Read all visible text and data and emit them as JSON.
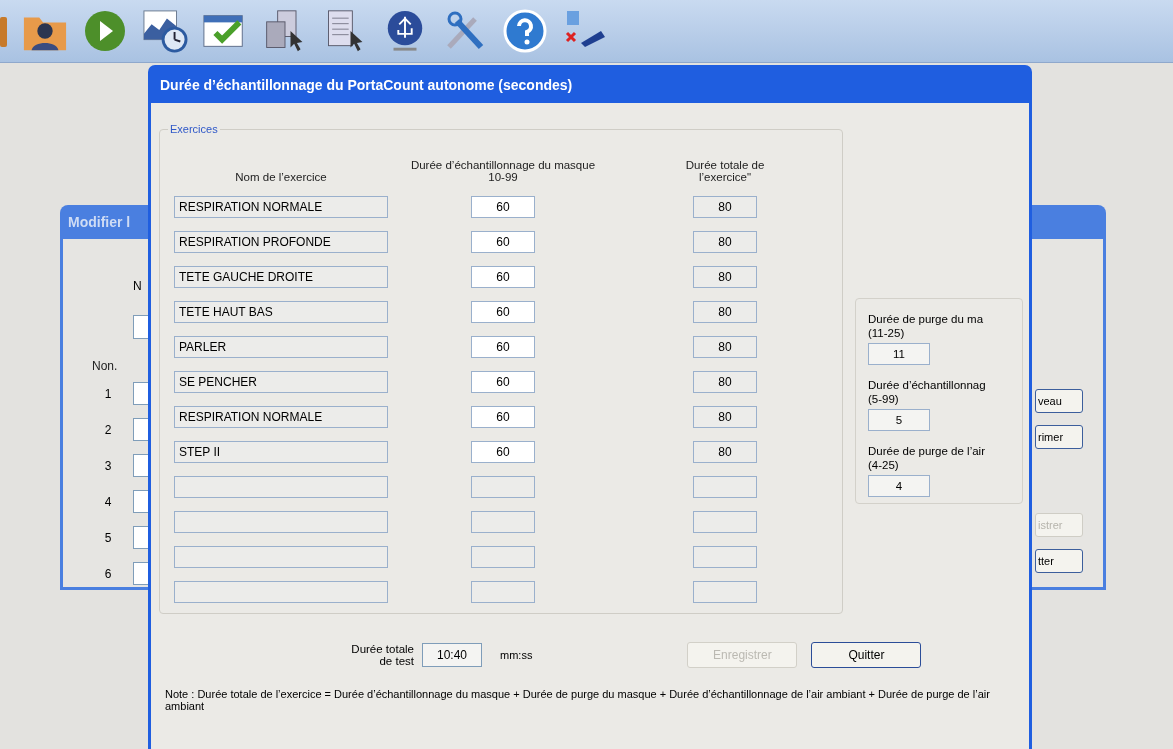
{
  "background_window": {
    "title": "Modifier l",
    "label_top": "N",
    "column_label": "Non.",
    "row_numbers": [
      "1",
      "2",
      "3",
      "4",
      "5",
      "6"
    ],
    "buttons": [
      {
        "label": "veau",
        "disabled": false
      },
      {
        "label": "rimer",
        "disabled": false
      },
      {
        "label": "istrer",
        "disabled": true
      },
      {
        "label": "tter",
        "disabled": false
      }
    ]
  },
  "dialog": {
    "title": "Durée d’échantillonnage du PortaCount autonome (secondes)",
    "group_title": "Exercices",
    "columns": [
      {
        "label": "Nom de l’exercice"
      },
      {
        "label": "Durée d’échantillonnage du masque",
        "range": "10-99"
      },
      {
        "label": "Durée totale de l’exercice\""
      }
    ],
    "rows": [
      {
        "kind": "filled",
        "name": "RESPIRATION NORMALE",
        "sampling": "60",
        "total": "80"
      },
      {
        "kind": "filled",
        "name": "RESPIRATION PROFONDE",
        "sampling": "60",
        "total": "80"
      },
      {
        "kind": "filled",
        "name": "TETE GAUCHE DROITE",
        "sampling": "60",
        "total": "80"
      },
      {
        "kind": "filled",
        "name": "TETE HAUT BAS",
        "sampling": "60",
        "total": "80"
      },
      {
        "kind": "filled",
        "name": "PARLER",
        "sampling": "60",
        "total": "80"
      },
      {
        "kind": "filled",
        "name": "SE PENCHER",
        "sampling": "60",
        "total": "80"
      },
      {
        "kind": "filled",
        "name": "RESPIRATION NORMALE",
        "sampling": "60",
        "total": "80"
      },
      {
        "kind": "filled",
        "name": "STEP II",
        "sampling": "60",
        "total": "80"
      },
      {
        "kind": "blank"
      },
      {
        "kind": "blank"
      },
      {
        "kind": "blank"
      },
      {
        "kind": "blank"
      }
    ],
    "settings": [
      {
        "label": "Durée de purge du ma",
        "range": "(11-25)",
        "value": "11"
      },
      {
        "label": "Durée d’échantillonnag",
        "range": "(5-99)",
        "value": "5"
      },
      {
        "label": "Durée de purge de l’air",
        "range": "(4-25)",
        "value": "4"
      }
    ],
    "total_label": "Durée totale de test",
    "total_value": "10:40",
    "total_unit": "mm:ss",
    "buttons": [
      {
        "label": "Enregistrer",
        "disabled": true
      },
      {
        "label": "Quitter",
        "disabled": false
      }
    ],
    "note": "Note : Durée totale de l’exercice = Durée d’échantillonnage du masque + Durée de purge du masque + Durée d’échantillonnage de l’air ambiant + Durée de purge de l’air ambiant"
  }
}
